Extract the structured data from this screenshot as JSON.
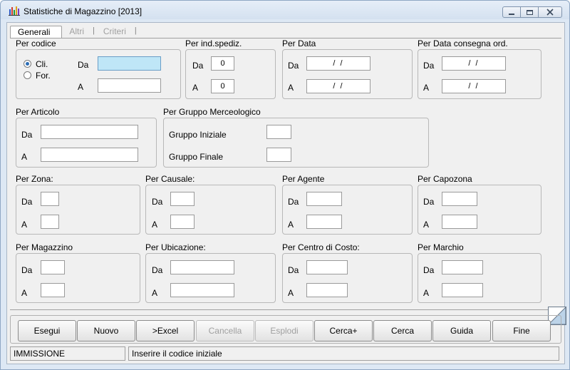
{
  "window": {
    "title": "Statistiche di Magazzino [2013]"
  },
  "tabs": [
    "Generali",
    "Altri",
    "Criteri"
  ],
  "labels": {
    "da": "Da",
    "a": "A"
  },
  "codice": {
    "title": "Per codice",
    "radio_cli": "Cli.",
    "radio_for": "For.",
    "selected": "Cli.",
    "da_value": "",
    "a_value": ""
  },
  "spediz": {
    "title": "Per ind.spediz.",
    "da_value": "0",
    "a_value": "0"
  },
  "data": {
    "title": "Per Data",
    "da_value": "/ /",
    "a_value": "/ /"
  },
  "consegna": {
    "title": "Per Data consegna ord.",
    "da_value": "/ /",
    "a_value": "/ /"
  },
  "articolo": {
    "title": "Per Articolo",
    "da_value": "",
    "a_value": ""
  },
  "gruppo": {
    "title": "Per Gruppo Merceologico",
    "iniziale_label": "Gruppo Iniziale",
    "finale_label": "Gruppo Finale",
    "iniziale_value": "",
    "finale_value": ""
  },
  "zona": {
    "title": "Per Zona:",
    "da_value": "",
    "a_value": ""
  },
  "causale": {
    "title": "Per Causale:",
    "da_value": "",
    "a_value": ""
  },
  "agente": {
    "title": "Per Agente",
    "da_value": "",
    "a_value": ""
  },
  "capozona": {
    "title": "Per Capozona",
    "da_value": "",
    "a_value": ""
  },
  "magazzino": {
    "title": "Per Magazzino",
    "da_value": "",
    "a_value": ""
  },
  "ubicazione": {
    "title": "Per Ubicazione:",
    "da_value": "",
    "a_value": ""
  },
  "centro": {
    "title": "Per Centro di Costo:",
    "da_value": "",
    "a_value": ""
  },
  "marchio": {
    "title": "Per Marchio",
    "da_value": "",
    "a_value": ""
  },
  "buttons": {
    "esegui": "Esegui",
    "nuovo": "Nuovo",
    "excel": ">Excel",
    "cancella": "Cancella",
    "esplodi": "Esplodi",
    "cerca_plus": "Cerca+",
    "cerca": "Cerca",
    "guida": "Guida",
    "fine": "Fine"
  },
  "status": {
    "mode": "IMMISSIONE",
    "message": "Inserire il codice iniziale"
  },
  "colors": {
    "focus_field": "#bfe6f7",
    "window_frame": "#dde8f4",
    "face": "#f0f0f0"
  }
}
